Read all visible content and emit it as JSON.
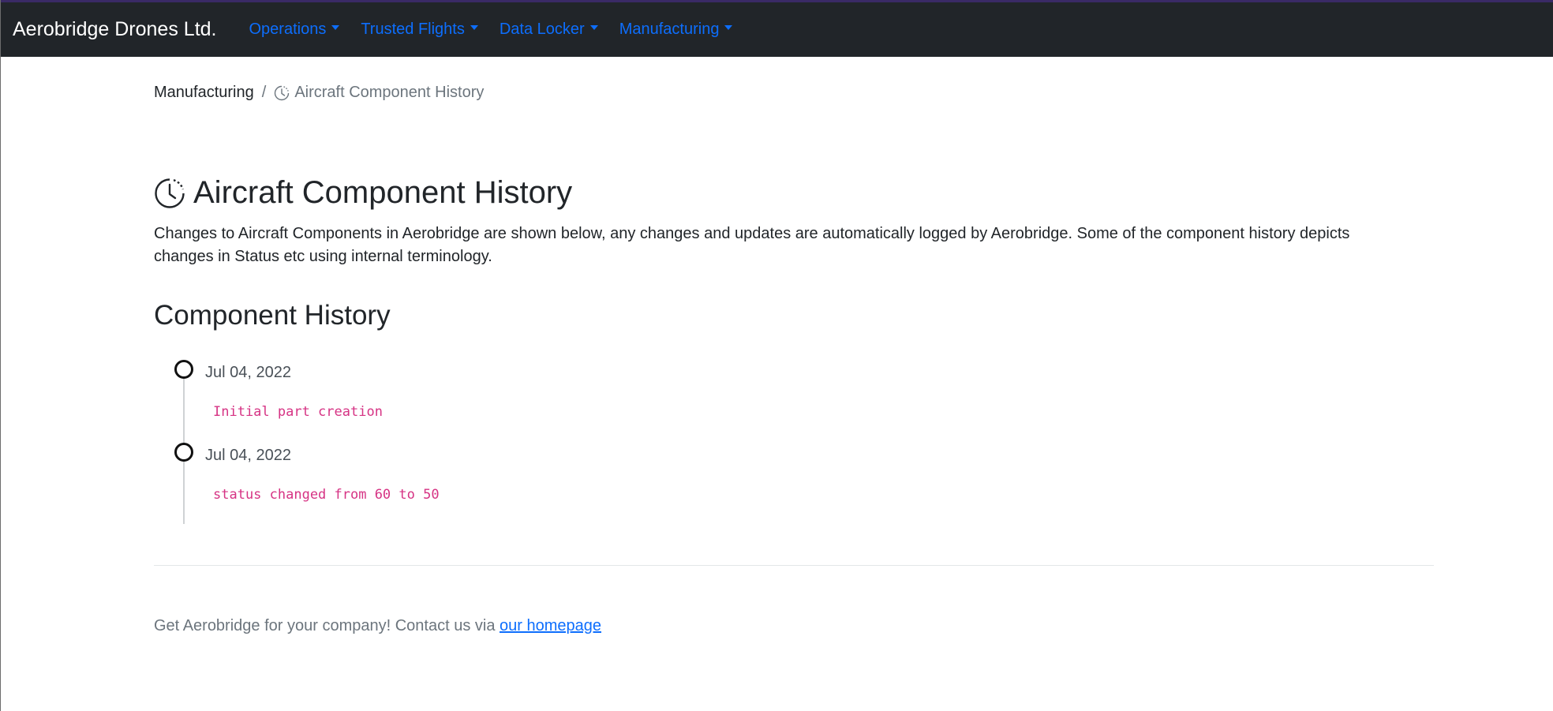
{
  "navbar": {
    "brand": "Aerobridge Drones Ltd.",
    "items": [
      {
        "label": "Operations"
      },
      {
        "label": "Trusted Flights"
      },
      {
        "label": "Data Locker"
      },
      {
        "label": "Manufacturing"
      }
    ]
  },
  "breadcrumb": {
    "parent": "Manufacturing",
    "separator": "/",
    "current": "Aircraft Component History",
    "current_icon": "clock-icon"
  },
  "page": {
    "title": "Aircraft Component History",
    "title_icon": "clock-icon",
    "description": "Changes to Aircraft Components in Aerobridge are shown below, any changes and updates are automatically logged by Aerobridge. Some of the component history depicts changes in Status etc using internal terminology."
  },
  "history": {
    "title": "Component History",
    "entries": [
      {
        "date": "Jul 04, 2022",
        "text": "Initial part creation"
      },
      {
        "date": "Jul 04, 2022",
        "text": "status changed from 60 to 50"
      }
    ]
  },
  "footer": {
    "text": "Get Aerobridge for your company! Contact us via",
    "link_text": "our homepage"
  },
  "colors": {
    "navbar_bg": "#212529",
    "link": "#0d6efd",
    "code": "#d63384",
    "muted": "#6c757d"
  }
}
